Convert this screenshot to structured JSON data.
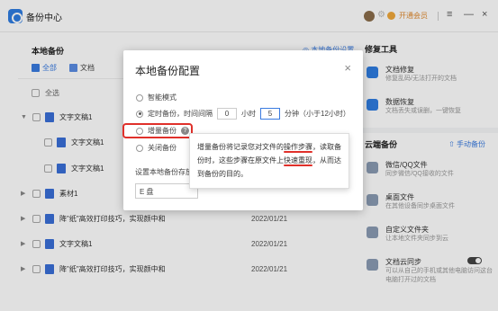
{
  "app": {
    "title": "备份中心",
    "member_label": "开通会员",
    "menu_glyph": "≡",
    "minimize_glyph": "—",
    "close_glyph": "×"
  },
  "left": {
    "title": "本地备份",
    "settings_link": "◎ 本地备份设置",
    "filters": [
      "全部",
      "文档"
    ],
    "select_all": "全选",
    "rows": [
      {
        "name": "文字文稿1",
        "date": "",
        "expanded": true
      },
      {
        "name": "文字文稿1",
        "date": "",
        "child": true
      },
      {
        "name": "文字文稿1",
        "date": "",
        "child": true
      },
      {
        "name": "素材1",
        "date": ""
      },
      {
        "name": "降\"纸\"高效打印技巧，实现颜中和",
        "date": "2022/01/21"
      },
      {
        "name": "文字文稿1",
        "date": "2022/01/21"
      },
      {
        "name": "降\"纸\"高效打印技巧，实现颜中和",
        "date": "2022/01/21"
      }
    ]
  },
  "right": {
    "repair_head": "修复工具",
    "tools": [
      {
        "title": "文档修复",
        "desc": "修复乱码/无法打开的文档"
      },
      {
        "title": "数据恢复",
        "desc": "文档丢失或误删，一键恢复"
      }
    ],
    "cloud_head": "云端备份",
    "cloud_link": "⇧ 手动备份",
    "cloud_tools": [
      {
        "title": "微信/QQ文件",
        "desc": "同步微信/QQ接收的文件"
      },
      {
        "title": "桌面文件",
        "desc": "在其他设备同步桌面文件"
      },
      {
        "title": "自定义文件夹",
        "desc": "让本地文件夹同步到云"
      },
      {
        "title": "文档云同步",
        "desc": "可以从自己的手机或其他电脑访问这台电脑打开过的文档"
      }
    ]
  },
  "dialog": {
    "title": "本地备份配置",
    "close": "×",
    "options": {
      "smart": "智能模式",
      "timed_prefix": "定时备份，时间间隔",
      "hours_value": "0",
      "hours_unit": "小时",
      "minutes_value": "5",
      "minutes_unit": "分钟（小于12小时）",
      "incremental": "增量备份",
      "off": "关闭备份"
    },
    "path_label": "设置本地备份存放",
    "drive": "E 盘"
  },
  "tooltip": {
    "line1_a": "增量备份将记录您对文件的",
    "line1_b": "操作步骤",
    "line1_c": "，读取备",
    "line2_a": "份时，这些步骤在原文件上",
    "line2_b": "快速重现",
    "line2_c": "，从而达",
    "line3": "到备份的目的。"
  }
}
